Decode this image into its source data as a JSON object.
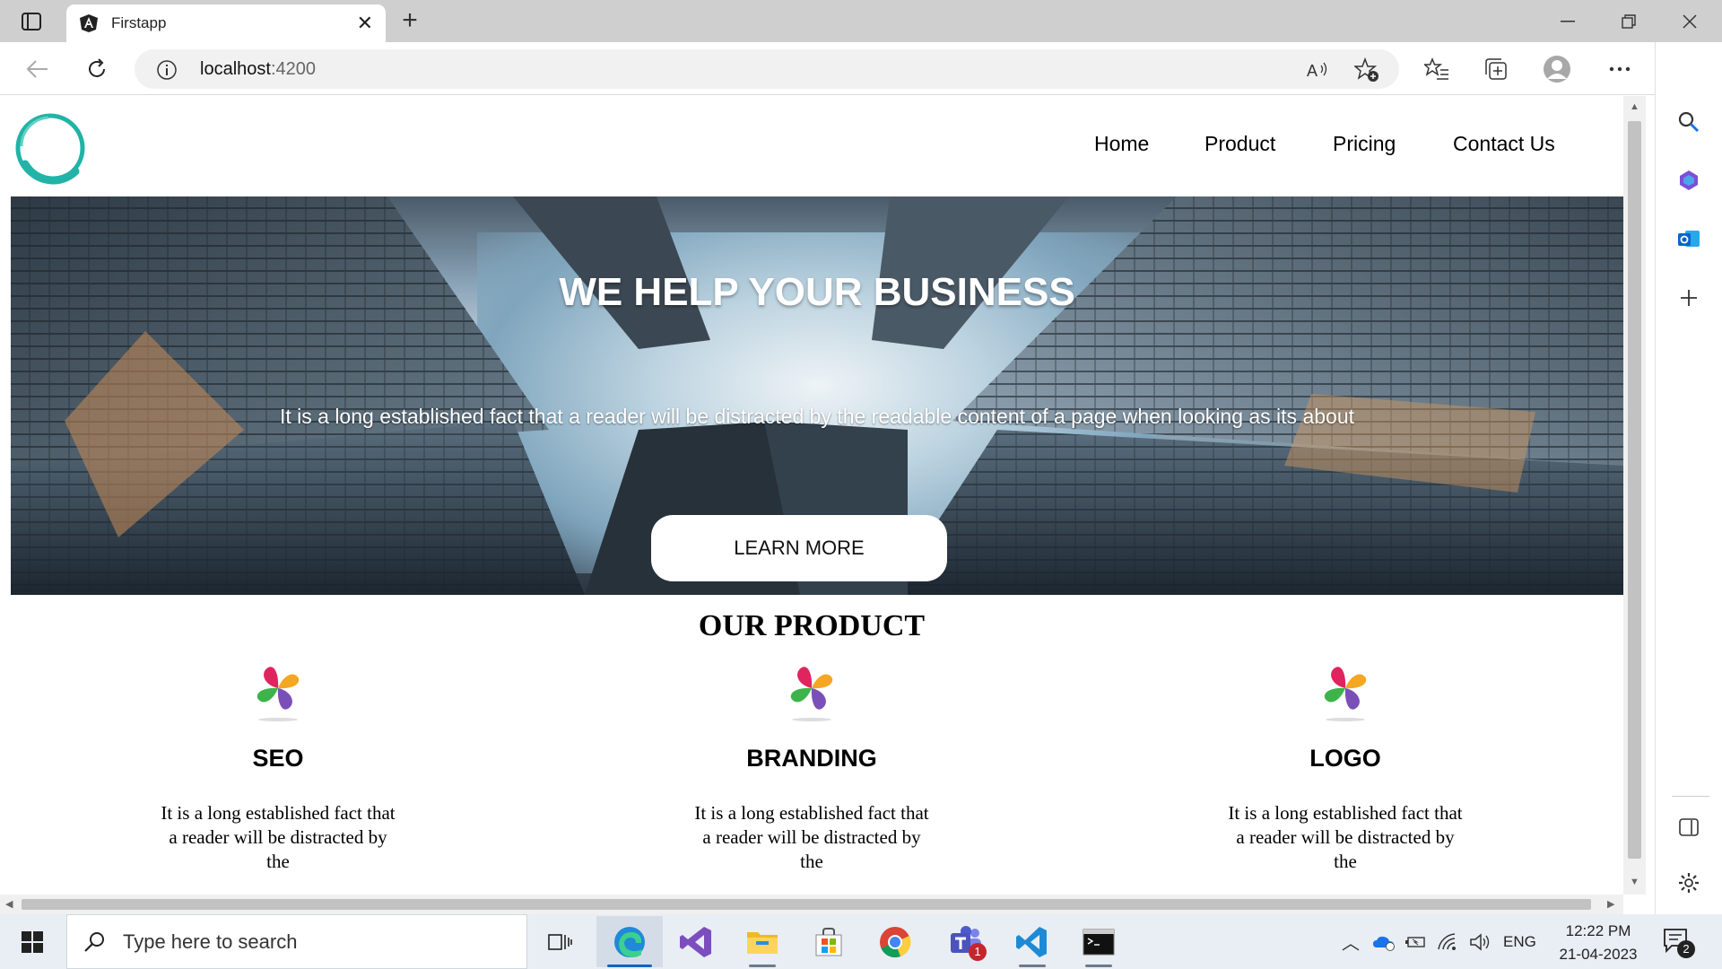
{
  "browser": {
    "tab_title": "Firstapp",
    "url_host": "localhost",
    "url_port": ":4200"
  },
  "nav": {
    "items": [
      "Home",
      "Product",
      "Pricing",
      "Contact Us"
    ]
  },
  "hero": {
    "title": "WE HELP YOUR BUSINESS",
    "subtitle": "It is a long established fact that a reader will be distracted by the readable content of a page when looking as its about",
    "button_label": "LEARN MORE"
  },
  "products": {
    "heading": "OUR PRODUCT",
    "cards": [
      {
        "title": "SEO",
        "text": "It is a long established fact that a reader will be distracted by the"
      },
      {
        "title": "BRANDING",
        "text": "It is a long established fact that a reader will be distracted by the"
      },
      {
        "title": "LOGO",
        "text": "It is a long established fact that a reader will be distracted by the"
      }
    ]
  },
  "taskbar": {
    "search_placeholder": "Type here to search",
    "language": "ENG",
    "time": "12:22 PM",
    "date": "21-04-2023",
    "teams_badge": "1",
    "notification_badge": "2"
  },
  "colors": {
    "logo_accent": "#21b3a7",
    "edge_active_underline": "#0a64c8",
    "tabbar_background": "#cfcfcf"
  }
}
